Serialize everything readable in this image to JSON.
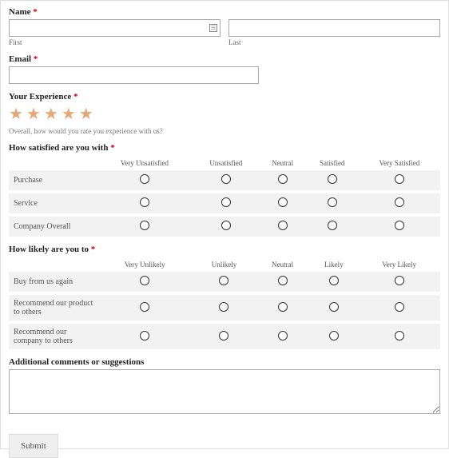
{
  "form": {
    "name": {
      "label": "Name",
      "first_sub": "First",
      "last_sub": "Last"
    },
    "email": {
      "label": "Email"
    },
    "experience": {
      "label": "Your Experience",
      "helper": "Overall, how would you rate you experience with us?",
      "stars": 5
    },
    "satisfaction": {
      "label": "How satisfied are you with",
      "columns": [
        "Very Unsatisfied",
        "Unsatisfied",
        "Neutral",
        "Satisfied",
        "Very Satisfied"
      ],
      "rows": [
        "Purchase",
        "Service",
        "Company Overall"
      ]
    },
    "likelihood": {
      "label": "How likely are you to",
      "columns": [
        "Very Unlikely",
        "Unlikely",
        "Neutral",
        "Likely",
        "Very Likely"
      ],
      "rows": [
        "Buy from us again",
        "Recommend our product to others",
        "Recommend our company to others"
      ]
    },
    "comments": {
      "label": "Additional comments or suggestions"
    },
    "submit": "Submit",
    "required": "*"
  }
}
